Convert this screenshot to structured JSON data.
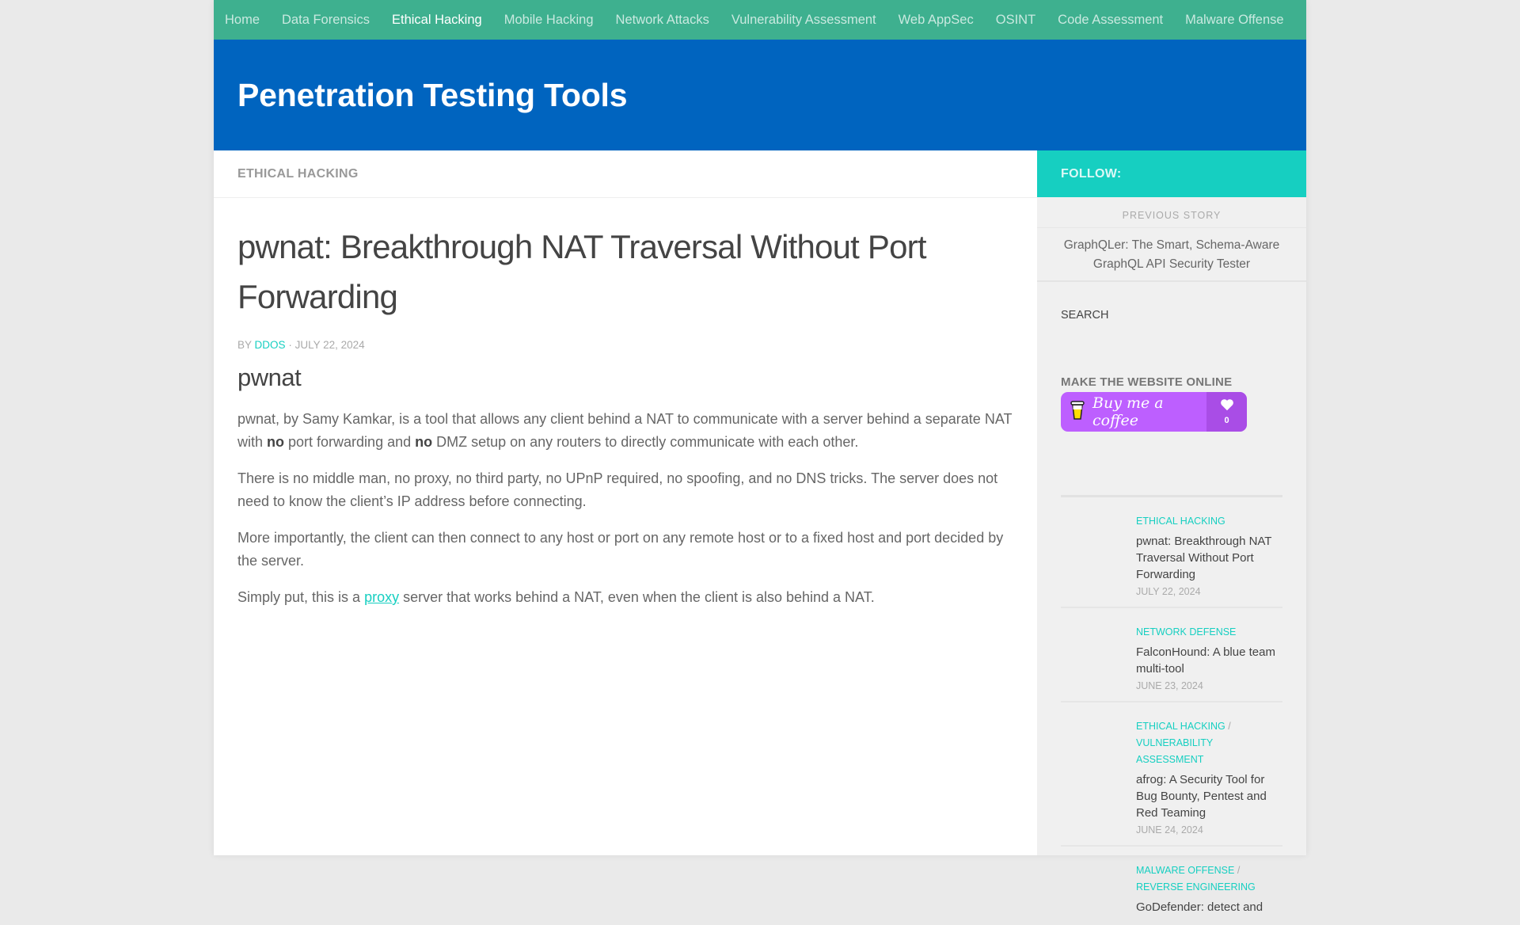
{
  "nav": {
    "items": [
      {
        "label": "Home",
        "active": false
      },
      {
        "label": "Data Forensics",
        "active": false
      },
      {
        "label": "Ethical Hacking",
        "active": true
      },
      {
        "label": "Mobile Hacking",
        "active": false
      },
      {
        "label": "Network Attacks",
        "active": false
      },
      {
        "label": "Vulnerability Assessment",
        "active": false
      },
      {
        "label": "Web AppSec",
        "active": false
      },
      {
        "label": "OSINT",
        "active": false
      },
      {
        "label": "Code Assessment",
        "active": false
      },
      {
        "label": "Malware Offense",
        "active": false
      }
    ]
  },
  "header": {
    "site_title": "Penetration Testing Tools"
  },
  "main": {
    "category_heading": "ETHICAL HACKING",
    "post_title": "pwnat: Breakthrough NAT Traversal Without Port Forwarding",
    "meta": {
      "by": "BY",
      "author": "DDOS",
      "separator": "·",
      "date": "JULY 22, 2024"
    },
    "subheading": "pwnat",
    "paragraphs": {
      "p1_a": "pwnat, by Samy Kamkar, is a tool that allows any client behind a NAT to communicate with a server behind a separate NAT with ",
      "p1_b1": "no",
      "p1_c": " port forwarding and ",
      "p1_b2": "no",
      "p1_d": " DMZ setup on any routers to directly communicate with each other.",
      "p2": "There is no middle man, no proxy, no third party, no UPnP required, no spoofing, and no DNS tricks. The server does not need to know the client’s IP address before connecting.",
      "p3": "More importantly, the client can then connect to any host or port on any remote host or to a fixed host and port decided by the server.",
      "p4_a": "Simply put, this is a ",
      "p4_link": "proxy",
      "p4_b": " server that works behind a NAT, even when the client is also behind a NAT."
    }
  },
  "sidebar": {
    "follow_label": "FOLLOW:",
    "previous_story": {
      "label": "PREVIOUS STORY",
      "title": "GraphQLer: The Smart, Schema-Aware GraphQL API Security Tester"
    },
    "search_title": "SEARCH",
    "coffee_widget_title": "MAKE THE WEBSITE ONLINE",
    "coffee_button": {
      "label": "Buy me a coffee",
      "count": "0"
    },
    "posts": [
      {
        "cats": [
          "ETHICAL HACKING"
        ],
        "title": "pwnat: Breakthrough NAT Traversal Without Port Forwarding",
        "date": "JULY 22, 2024"
      },
      {
        "cats": [
          "NETWORK DEFENSE"
        ],
        "title": "FalconHound: A blue team multi-tool",
        "date": "JUNE 23, 2024"
      },
      {
        "cats": [
          "ETHICAL HACKING",
          "VULNERABILITY ASSESSMENT"
        ],
        "title": "afrog: A Security Tool for Bug Bounty, Pentest and Red Teaming",
        "date": "JUNE 24, 2024"
      },
      {
        "cats": [
          "MALWARE OFFENSE",
          "REVERSE ENGINEERING"
        ],
        "title": "GoDefender: detect and",
        "date": ""
      }
    ]
  },
  "colors": {
    "nav_bg": "#3eb08f",
    "header_bg": "#0064bf",
    "accent": "#16cfc1",
    "coffee_button": "#bd5fff"
  }
}
